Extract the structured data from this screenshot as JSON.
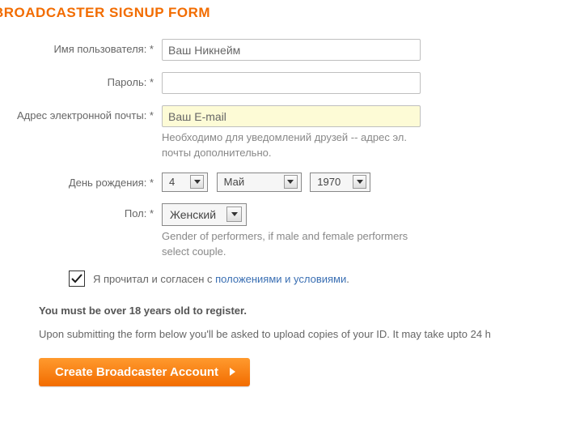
{
  "title": "BROADCASTER SIGNUP FORM",
  "labels": {
    "username": "Имя пользователя: *",
    "password": "Пароль: *",
    "email": "Адрес электронной почты: *",
    "birthday": "День рождения: *",
    "gender": "Пол: *"
  },
  "fields": {
    "username_value": "Ваш Никнейм",
    "password_value": "",
    "email_value": "Ваш E-mail",
    "email_hint": "Необходимо для уведомлений друзей -- адрес эл. почты дополнительно.",
    "day": "4",
    "month": "Май",
    "year": "1970",
    "gender": "Женский",
    "gender_hint": "Gender of performers, if male and female performers select couple."
  },
  "agree": {
    "prefix": "Я прочитал и согласен с ",
    "link": "положениями и условиями",
    "suffix": "."
  },
  "note": "You must be over 18 years old to register.",
  "desc": "Upon submitting the form below you'll be asked to upload copies of your ID. It may take upto 24 h",
  "submit": "Create Broadcaster Account"
}
